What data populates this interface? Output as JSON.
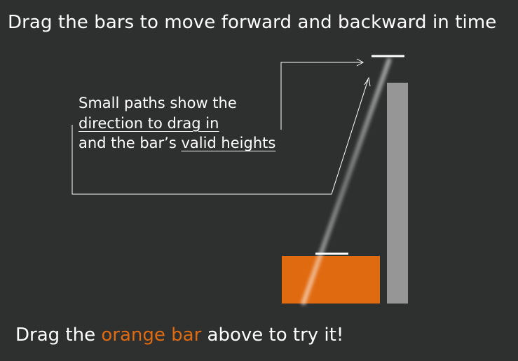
{
  "title": "Drag the bars to move forward and backward in time",
  "callout": {
    "line1": "Small paths show the",
    "line2": "direction to drag in",
    "line3_prefix": "and the bar’s ",
    "line3_link": "valid heights"
  },
  "footer": {
    "prefix": "Drag the ",
    "accent": "orange bar",
    "suffix": " above to try it!"
  },
  "colors": {
    "background": "#2e2f2f",
    "orange_bar": "#e06a10",
    "gray_bar": "#969696",
    "accent_text": "#e06a10"
  }
}
